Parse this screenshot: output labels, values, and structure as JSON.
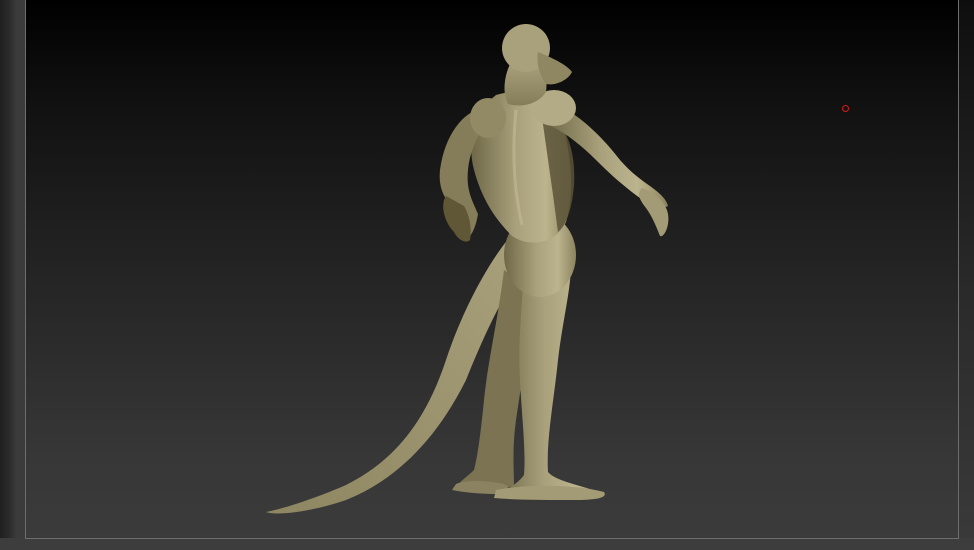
{
  "viewport": {
    "background_top": "#000000",
    "background_bottom": "#3b3b3b",
    "model_color": "#a8a07a",
    "model_shadow": "#6a6346",
    "cursor_color": "#d81c1c"
  },
  "icons": {
    "cursor": "red-circle-cursor-icon"
  }
}
